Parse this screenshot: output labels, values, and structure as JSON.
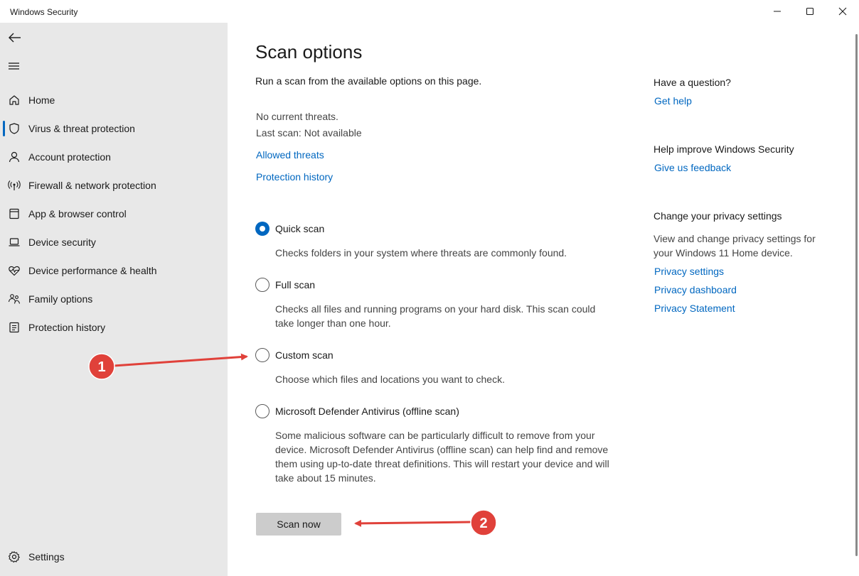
{
  "window": {
    "title": "Windows Security"
  },
  "sidebar": {
    "items": [
      {
        "label": "Home",
        "icon": "home-icon",
        "selected": false
      },
      {
        "label": "Virus & threat protection",
        "icon": "shield-icon",
        "selected": true
      },
      {
        "label": "Account protection",
        "icon": "person-icon",
        "selected": false
      },
      {
        "label": "Firewall & network protection",
        "icon": "antenna-icon",
        "selected": false
      },
      {
        "label": "App & browser control",
        "icon": "app-window-icon",
        "selected": false
      },
      {
        "label": "Device security",
        "icon": "laptop-icon",
        "selected": false
      },
      {
        "label": "Device performance & health",
        "icon": "heart-pulse-icon",
        "selected": false
      },
      {
        "label": "Family options",
        "icon": "family-icon",
        "selected": false
      },
      {
        "label": "Protection history",
        "icon": "history-icon",
        "selected": false
      }
    ],
    "settings_label": "Settings"
  },
  "main": {
    "title": "Scan options",
    "subtitle": "Run a scan from the available options on this page.",
    "status_threats": "No current threats.",
    "status_last_scan": "Last scan: Not available",
    "links": {
      "allowed_threats": "Allowed threats",
      "protection_history": "Protection history"
    },
    "scan_options": [
      {
        "label": "Quick scan",
        "description": "Checks folders in your system where threats are commonly found.",
        "checked": true
      },
      {
        "label": "Full scan",
        "description": "Checks all files and running programs on your hard disk. This scan could take longer than one hour.",
        "checked": false
      },
      {
        "label": "Custom scan",
        "description": "Choose which files and locations you want to check.",
        "checked": false
      },
      {
        "label": "Microsoft Defender Antivirus (offline scan)",
        "description": "Some malicious software can be particularly difficult to remove from your device. Microsoft Defender Antivirus (offline scan) can help find and remove them using up-to-date threat definitions. This will restart your device and will take about 15 minutes.",
        "checked": false
      }
    ],
    "scan_button": "Scan now"
  },
  "right": {
    "question_heading": "Have a question?",
    "get_help": "Get help",
    "improve_heading": "Help improve Windows Security",
    "feedback": "Give us feedback",
    "privacy_heading": "Change your privacy settings",
    "privacy_text": "View and change privacy settings for your Windows 11 Home device.",
    "privacy_settings": "Privacy settings",
    "privacy_dashboard": "Privacy dashboard",
    "privacy_statement": "Privacy Statement"
  },
  "annotations": {
    "marker_1": "1",
    "marker_2": "2",
    "color": "#e0413a"
  },
  "colors": {
    "accent": "#0067c0",
    "sidebar_bg": "#e8e8e8",
    "button_bg": "#cccccc"
  }
}
